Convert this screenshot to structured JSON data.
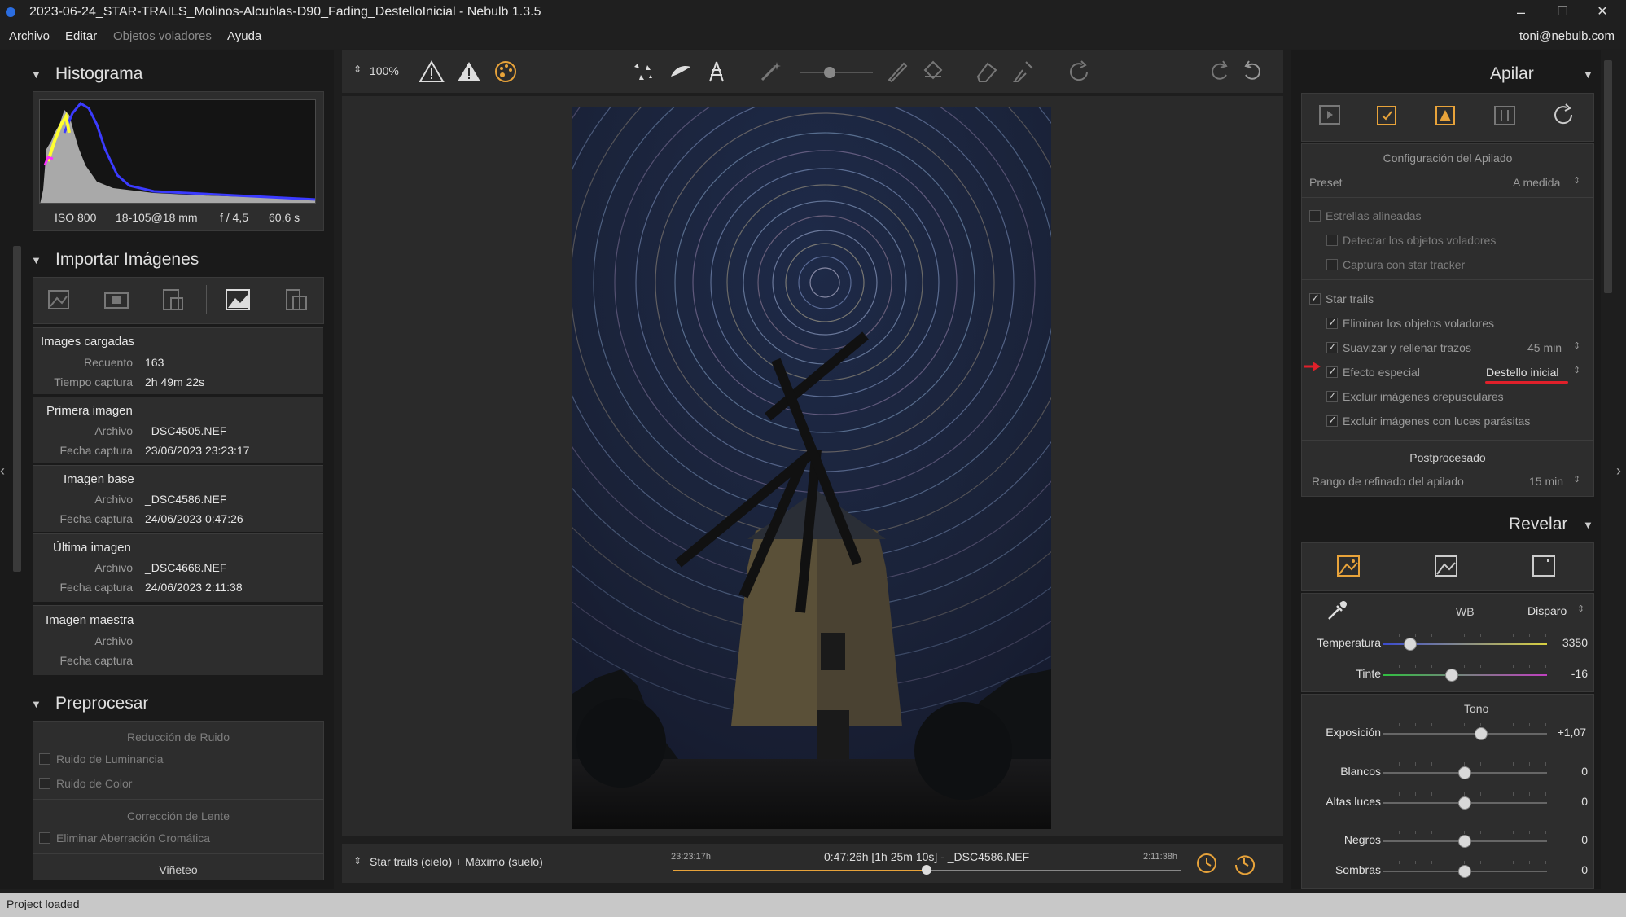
{
  "window": {
    "title": "2023-06-24_STAR-TRAILS_Molinos-Alcublas-D90_Fading_DestelloInicial - Nebulb 1.3.5",
    "minimize": "–",
    "maximize": "☐",
    "close": "✕"
  },
  "menu": {
    "items": [
      "Archivo",
      "Editar",
      "Objetos voladores",
      "Ayuda"
    ],
    "user": "toni@nebulb.com"
  },
  "histograma": {
    "title": "Histograma",
    "iso": "ISO 800",
    "lens": "18-105@18 mm",
    "aperture": "f / 4,5",
    "exposure": "60,6 s"
  },
  "importar": {
    "title": "Importar Imágenes",
    "groups": {
      "cargadas": {
        "title": "Images cargadas",
        "l1": "Recuento",
        "v1": "163",
        "l2": "Tiempo captura",
        "v2": "2h 49m 22s"
      },
      "primera": {
        "title": "Primera imagen",
        "l1": "Archivo",
        "v1": "_DSC4505.NEF",
        "l2": "Fecha captura",
        "v2": "23/06/2023 23:23:17"
      },
      "base": {
        "title": "Imagen base",
        "l1": "Archivo",
        "v1": "_DSC4586.NEF",
        "l2": "Fecha captura",
        "v2": "24/06/2023 0:47:26"
      },
      "ultima": {
        "title": "Última imagen",
        "l1": "Archivo",
        "v1": "_DSC4668.NEF",
        "l2": "Fecha captura",
        "v2": "24/06/2023 2:11:38"
      },
      "maestra": {
        "title": "Imagen maestra",
        "l1": "Archivo",
        "v1": "",
        "l2": "Fecha captura",
        "v2": ""
      }
    }
  },
  "preprocesar": {
    "title": "Preprocesar",
    "ruido_title": "Reducción de Ruido",
    "ruido_lum": "Ruido de Luminancia",
    "ruido_color": "Ruido de Color",
    "lente_title": "Corrección de Lente",
    "aberracion": "Eliminar Aberración Cromática",
    "vineteo": "Viñeteo"
  },
  "toolbar": {
    "zoom": "100%"
  },
  "footer": {
    "mode": "Star trails (cielo) + Máximo (suelo)",
    "start": "23:23:17h",
    "current": "0:47:26h [1h 25m 10s] - _DSC4586.NEF",
    "end": "2:11:38h",
    "position": 0.5
  },
  "apilar": {
    "title": "Apilar",
    "config_title": "Configuración del Apilado",
    "preset_label": "Preset",
    "preset_value": "A medida",
    "estrellas": "Estrellas alineadas",
    "detectar": "Detectar los objetos voladores",
    "captura": "Captura con star tracker",
    "startrails": "Star trails",
    "eliminar": "Eliminar los objetos voladores",
    "suavizar": "Suavizar y rellenar trazos",
    "suavizar_value": "45 min",
    "efecto": "Efecto especial",
    "efecto_value": "Destello inicial",
    "excluir_crep": "Excluir imágenes crepusculares",
    "excluir_luces": "Excluir imágenes con luces parásitas",
    "post_title": "Postprocesado",
    "rango_label": "Rango de refinado del apilado",
    "rango_value": "15 min"
  },
  "revelar": {
    "title": "Revelar",
    "wb_label": "WB",
    "wb_value": "Disparo",
    "temperatura": {
      "label": "Temperatura",
      "value": "3350",
      "pos": 0.17
    },
    "tinte": {
      "label": "Tinte",
      "value": "-16",
      "pos": 0.42
    },
    "tono_title": "Tono",
    "exposicion": {
      "label": "Exposición",
      "value": "+1,07",
      "pos": 0.6
    },
    "blancos": {
      "label": "Blancos",
      "value": "0",
      "pos": 0.5
    },
    "altas": {
      "label": "Altas luces",
      "value": "0",
      "pos": 0.5
    },
    "negros": {
      "label": "Negros",
      "value": "0",
      "pos": 0.5
    },
    "sombras": {
      "label": "Sombras",
      "value": "0",
      "pos": 0.5
    }
  },
  "colors": {
    "accent": "#e8a33a",
    "annotation": "#e0202a"
  },
  "status": "Project loaded"
}
